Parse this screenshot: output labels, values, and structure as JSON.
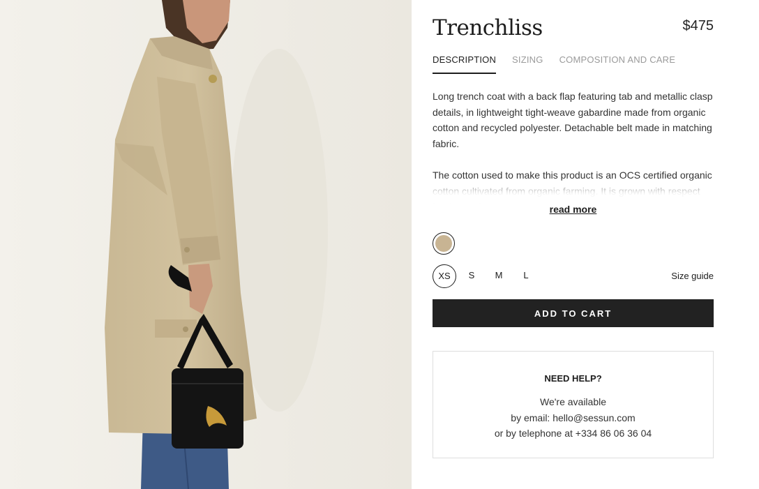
{
  "product": {
    "title": "Trenchliss",
    "price": "$475",
    "image_icon": "product-photo"
  },
  "tabs": [
    {
      "label": "DESCRIPTION",
      "active": true
    },
    {
      "label": "SIZING",
      "active": false
    },
    {
      "label": "COMPOSITION AND CARE",
      "active": false
    }
  ],
  "description": {
    "paragraph1": "Long trench coat with a back flap featuring tab and metallic clasp details, in lightweight tight-weave gabardine made from organic cotton and recycled polyester. Detachable belt made in matching fabric.",
    "paragraph2": "The cotton used to make this product is an OCS certified organic cotton cultivated from organic farming. It is grown with respect for the environment.",
    "read_more": "read more"
  },
  "colors": {
    "swatch": "#c8b493",
    "accent": "#222222"
  },
  "sizes": [
    {
      "label": "XS",
      "selected": true
    },
    {
      "label": "S",
      "selected": false
    },
    {
      "label": "M",
      "selected": false
    },
    {
      "label": "L",
      "selected": false
    }
  ],
  "size_guide": "Size guide",
  "cart": {
    "button_label": "ADD TO CART"
  },
  "help": {
    "title": "NEED HELP?",
    "line1": "We're available",
    "line2": "by email: hello@sessun.com",
    "line3": "or by telephone at +334 86 06 36 04"
  }
}
